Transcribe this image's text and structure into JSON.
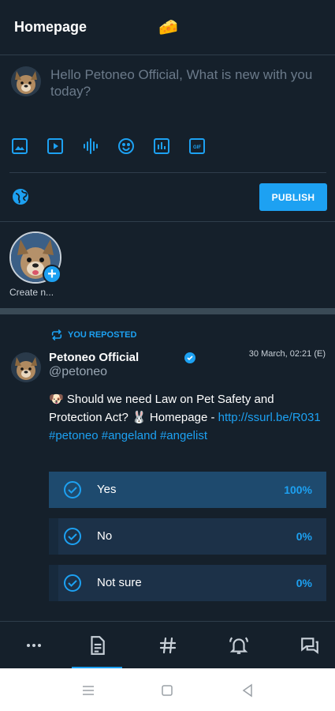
{
  "header": {
    "title": "Homepage",
    "emoji": "🧀"
  },
  "composer": {
    "placeholder": "Hello Petoneo Official, What is new with you today?",
    "publish_label": "PUBLISH",
    "tools": [
      "image-icon",
      "video-icon",
      "audio-icon",
      "emoji-icon",
      "poll-icon",
      "gif-icon"
    ]
  },
  "stories": {
    "create_label": "Create n..."
  },
  "post": {
    "repost_label": "YOU REPOSTED",
    "author": "Petoneo Official",
    "handle": "@petoneo",
    "timestamp": "30 March, 02:21  (E)",
    "text_plain": "🐶 Should we need Law on Pet Safety and Protection Act? 🐰 Homepage -",
    "text_link": "http://ssurl.be/R031 #petoneo #angeland #angelist",
    "poll": [
      {
        "label": "Yes",
        "percent": "100%",
        "value": 100
      },
      {
        "label": "No",
        "percent": "0%",
        "value": 0
      },
      {
        "label": "Not sure",
        "percent": "0%",
        "value": 0
      }
    ]
  },
  "bottom_nav": [
    "more-icon",
    "feed-icon",
    "hashtag-icon",
    "notifications-icon",
    "messages-icon"
  ],
  "colors": {
    "accent": "#1da1f2",
    "background": "#15202b",
    "poll_winner": "#1e4a6e"
  }
}
